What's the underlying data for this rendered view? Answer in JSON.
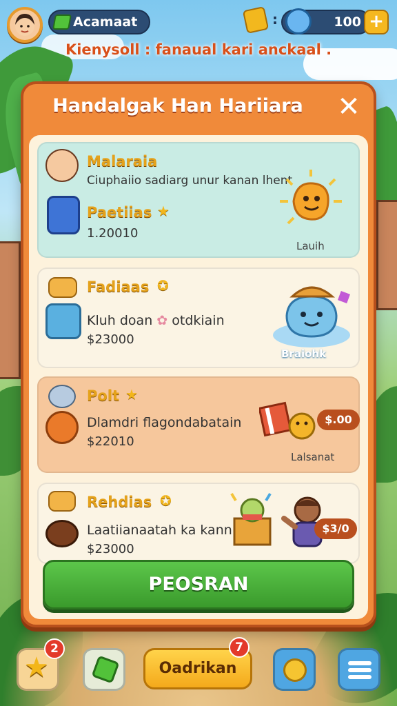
{
  "topbar": {
    "player_name": "Acamaat",
    "coin_count": "100",
    "colon": ":",
    "plus_label": "+",
    "message": "Kienysoll : fanaual kari anckaal ."
  },
  "dialog": {
    "title": "Handalgak Han Hariiara",
    "close_label": "✕",
    "cards": [
      {
        "name": "Malaraia",
        "description": "Ciuphaiio sadiarg unur kanan lhent",
        "item_name": "Paetiias",
        "price": "1.20010",
        "reward_label": "Lauih"
      },
      {
        "name": "Fadiaas",
        "description": "Kluh doan",
        "description_suffix": "otdkiain",
        "price": "$23000",
        "reward_label": "Braiohk"
      },
      {
        "name": "Polt",
        "description": "Dlamdri flagondabatain",
        "price": "$22010",
        "pill": "$.00",
        "reward_label": "Lalsanat"
      },
      {
        "name": "Rehdias",
        "description": "Laatiianaatah ka kann",
        "price": "$23000",
        "pill": "$3/0"
      }
    ],
    "cta_label": "PEOSRAN"
  },
  "bottom_nav": {
    "badge_left": "2",
    "main_label": "Oadrikan",
    "badge_main": "7"
  },
  "colors": {
    "dialog_orange": "#f08a3a",
    "cta_green": "#4cb33c",
    "title_gold": "#e5a21b",
    "badge_red": "#e33a2a"
  }
}
